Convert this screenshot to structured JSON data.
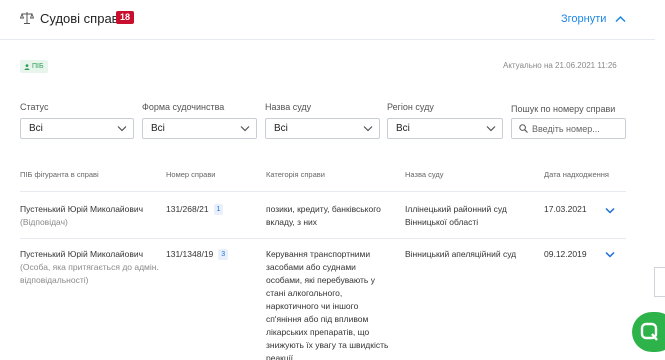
{
  "header": {
    "title": "Судові справи",
    "count": "18",
    "collapse_label": "Згорнути"
  },
  "tag": {
    "label": "ПІБ"
  },
  "actual_text": "Актуально на 21.06.2021 11:26",
  "filters": {
    "status": {
      "label": "Статус",
      "value": "Всі"
    },
    "form": {
      "label": "Форма судочинства",
      "value": "Всі"
    },
    "court": {
      "label": "Назва суду",
      "value": "Всі"
    },
    "region": {
      "label": "Регіон суду",
      "value": "Всі"
    },
    "search": {
      "label": "Пошук по номеру справи",
      "placeholder": "Введіть номер..."
    }
  },
  "table": {
    "headers": [
      "ПІБ фігуранта в справі",
      "Номер справи",
      "Категорія справи",
      "Назва суду",
      "Дата надходження"
    ],
    "rows": [
      {
        "name": "Пустенький Юрій Миколайович",
        "role": "(Відповідач)",
        "case_number": "131/268/21",
        "case_count": "1",
        "category": "позики, кредиту, банківського вкладу, з них",
        "court": "Іллінецький районний суд Вінницької області",
        "date": "17.03.2021"
      },
      {
        "name": "Пустенький Юрій Миколайович",
        "role": "(Особа, яка притягається до адмін. відповідальності)",
        "case_number": "131/1348/19",
        "case_count": "3",
        "category": "Керування транспортними засобами або суднами особами, які перебувають у стані алкогольного, наркотичного чи іншого сп'яніння або під впливом лікарських препаратів, що знижують їх увагу та швидкість реакції",
        "court": "Вінницький апеляційний суд",
        "date": "09.12.2019"
      }
    ]
  },
  "colors": {
    "accent": "#1e88e5",
    "badge_red": "#c8102e",
    "tag_green": "#2e9d57",
    "chat_green": "#2db34a"
  },
  "icons": [
    "scale-icon",
    "chevron-up-icon",
    "person-icon",
    "chevron-down-icon",
    "search-icon",
    "expand-chevron-icon",
    "chat-icon"
  ]
}
